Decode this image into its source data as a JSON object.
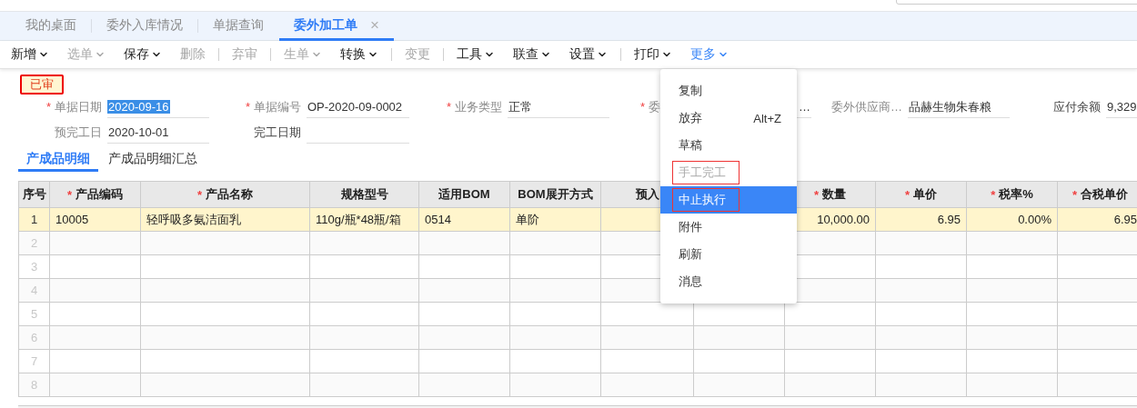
{
  "tabs": [
    {
      "label": "我的桌面",
      "selected": false
    },
    {
      "label": "委外入库情况",
      "selected": false
    },
    {
      "label": "单据查询",
      "selected": false
    },
    {
      "label": "委外加工单",
      "selected": true,
      "close": "×"
    }
  ],
  "toolbar": [
    {
      "label": "新增",
      "dropdown": true,
      "disabled": false,
      "selected": false,
      "divider_before": false
    },
    {
      "label": "选单",
      "dropdown": true,
      "disabled": true,
      "selected": false,
      "divider_before": false
    },
    {
      "label": "保存",
      "dropdown": true,
      "disabled": false,
      "selected": false,
      "divider_before": false
    },
    {
      "label": "删除",
      "dropdown": false,
      "disabled": true,
      "selected": false,
      "divider_before": false
    },
    {
      "label": "弃审",
      "dropdown": false,
      "disabled": true,
      "selected": false,
      "divider_before": true
    },
    {
      "label": "生单",
      "dropdown": true,
      "disabled": true,
      "selected": false,
      "divider_before": true
    },
    {
      "label": "转换",
      "dropdown": true,
      "disabled": false,
      "selected": false,
      "divider_before": false
    },
    {
      "label": "变更",
      "dropdown": false,
      "disabled": true,
      "selected": false,
      "divider_before": true
    },
    {
      "label": "工具",
      "dropdown": true,
      "disabled": false,
      "selected": false,
      "divider_before": true
    },
    {
      "label": "联查",
      "dropdown": true,
      "disabled": false,
      "selected": false,
      "divider_before": false
    },
    {
      "label": "设置",
      "dropdown": true,
      "disabled": false,
      "selected": false,
      "divider_before": false
    },
    {
      "label": "打印",
      "dropdown": true,
      "disabled": false,
      "selected": false,
      "divider_before": true
    },
    {
      "label": "更多",
      "dropdown": true,
      "disabled": false,
      "selected": true,
      "divider_before": false
    }
  ],
  "status_badge": "已审",
  "form_rows": [
    [
      {
        "star": "*",
        "label": "单据日期",
        "dark": false,
        "value": "2020-09-16",
        "selected": true
      },
      {
        "star": "*",
        "label": "单据编号",
        "dark": false,
        "value": "OP-2020-09-0002",
        "selected": false
      },
      {
        "star": "*",
        "label": "业务类型",
        "dark": false,
        "value": "正常",
        "selected": false
      },
      {
        "star": "*",
        "label": "委",
        "dark": false,
        "value": "…",
        "selected": false
      },
      {
        "label": "委外供应商…",
        "dark": false,
        "value": "品赫生物朱春粮",
        "selected": false
      },
      {
        "label": "应付余额",
        "dark": true,
        "value": "9,329",
        "selected": false
      }
    ],
    [
      {
        "label": "预完工日",
        "dark": false,
        "value": "2020-10-01",
        "selected": false
      },
      {
        "label": "完工日期",
        "dark": true
      }
    ]
  ],
  "subtabs": [
    {
      "label": "产成品明细",
      "selected": true
    },
    {
      "label": "产成品明细汇总",
      "selected": false
    }
  ],
  "table": {
    "columns": [
      {
        "label": "序号"
      },
      {
        "star": "*",
        "label": "产品编码"
      },
      {
        "star": "*",
        "label": "产品名称"
      },
      {
        "label": "规格型号"
      },
      {
        "label": "适用BOM"
      },
      {
        "label": "BOM展开方式"
      },
      {
        "label": "预入"
      },
      {},
      {
        "star": "*",
        "label": "数量"
      },
      {
        "star": "*",
        "label": "单价"
      },
      {
        "star": "*",
        "label": "税率%"
      },
      {
        "star": "*",
        "label": "合税单价"
      }
    ],
    "rows": [
      {
        "no": "1",
        "selected": true,
        "cells": [
          "10005",
          "轻呼吸多氨洁面乳",
          "110g/瓶*48瓶/箱",
          "0514",
          "单阶",
          null,
          null,
          "10,000.00",
          "6.95",
          "0.00%",
          "6.95"
        ]
      },
      {
        "no": "2",
        "selected": false
      },
      {
        "no": "3",
        "selected": false
      },
      {
        "no": "4",
        "selected": false
      },
      {
        "no": "5",
        "selected": false
      },
      {
        "no": "6",
        "selected": false
      },
      {
        "no": "7",
        "selected": false
      },
      {
        "no": "8",
        "selected": false
      }
    ]
  },
  "menu": [
    {
      "label": "复制",
      "disabled": false,
      "selected": false,
      "outlined": false
    },
    {
      "label": "放弃",
      "shortcut": "Alt+Z",
      "disabled": false,
      "selected": false,
      "outlined": false
    },
    {
      "label": "草稿",
      "disabled": false,
      "selected": false,
      "outlined": false
    },
    {
      "label": "手工完工",
      "disabled": true,
      "selected": false,
      "outlined": true
    },
    {
      "label": "中止执行",
      "disabled": false,
      "selected": true,
      "outlined": true
    },
    {
      "label": "附件",
      "disabled": false,
      "selected": false,
      "outlined": false
    },
    {
      "label": "刷新",
      "disabled": false,
      "selected": false,
      "outlined": false
    },
    {
      "label": "消息",
      "disabled": false,
      "selected": false,
      "outlined": false
    }
  ]
}
